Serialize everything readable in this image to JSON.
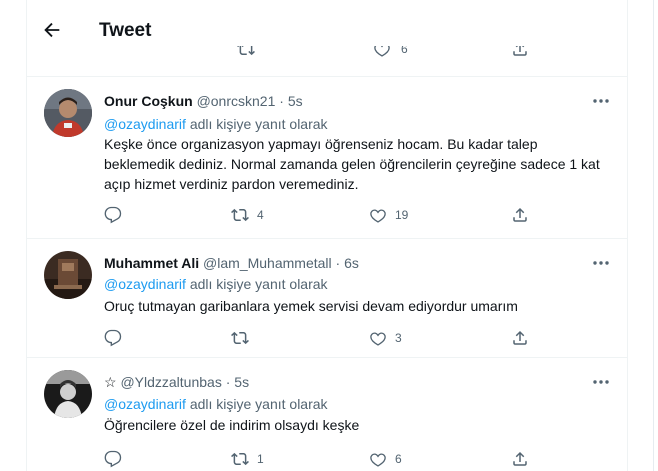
{
  "header": {
    "title": "Tweet",
    "back_icon": "arrow-left-icon"
  },
  "prev_actions": {
    "counts": [
      "",
      "",
      "6"
    ]
  },
  "reply_prefix": "adlı kişiye yanıt olarak",
  "tweets": [
    {
      "name": "Onur Coşkun",
      "handle": "@onrcskn21",
      "dot": "·",
      "time": "5s",
      "mention": "@ozaydinarif",
      "text": "Keşke önce organizasyon yapmayı öğrenseniz hocam. Bu kadar talep beklemedik dediniz. Normal zamanda gelen öğrencilerin çeyreğine sadece 1 kat açıp hizmet verdiniz pardon veremediniz.",
      "replies": "",
      "retweets": "4",
      "likes": "19"
    },
    {
      "name": "Muhammet Ali",
      "handle": "@lam_Muhammetall",
      "dot": "·",
      "time": "6s",
      "mention": "@ozaydinarif",
      "text": "Oruç tutmayan garibanlara yemek servisi devam ediyordur umarım",
      "replies": "",
      "retweets": "",
      "likes": "3"
    },
    {
      "name": "☆",
      "handle": "@Yldzzaltunbas",
      "dot": "·",
      "time": "5s",
      "mention": "@ozaydinarif",
      "text": "Öğrencilere özel de indirim olsaydı keşke",
      "replies": "",
      "retweets": "1",
      "likes": "6"
    }
  ],
  "colors": {
    "accent": "#1d9bf0",
    "secondary_text": "#536471",
    "border": "#eff3f4"
  }
}
